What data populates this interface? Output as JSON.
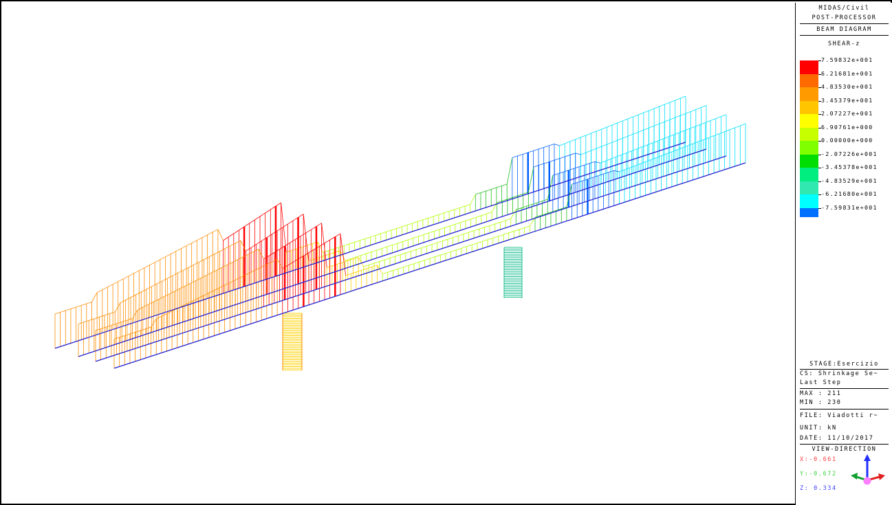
{
  "header": {
    "software": "MIDAS/Civil",
    "module": "POST-PROCESSOR",
    "diagram": "BEAM DIAGRAM",
    "component": "SHEAR-z"
  },
  "legend": {
    "labels": [
      "7.59832e+001",
      "6.21681e+001",
      "4.83530e+001",
      "3.45379e+001",
      "2.07227e+001",
      "6.90761e+000",
      "0.00000e+000",
      "-2.07226e+001",
      "-3.45378e+001",
      "-4.83529e+001",
      "-6.21680e+001",
      "-7.59831e+001"
    ],
    "colors": [
      "#ff0000",
      "#ff6a00",
      "#ff9a00",
      "#ffc600",
      "#ffff00",
      "#c8ff00",
      "#80ff00",
      "#00dd00",
      "#00ee80",
      "#30e8b0",
      "#00ffff",
      "#0070ff"
    ]
  },
  "info": {
    "stage": "STAGE:Esercizio",
    "cs_line1": "CS: Shrinkage Se~",
    "cs_line2": "Last Step",
    "max": "MAX : 211",
    "min": "MIN : 230",
    "file": "FILE: Viadotti r~",
    "unit": "UNIT: kN",
    "date": "DATE: 11/10/2017"
  },
  "view_direction": {
    "title": "VIEW-DIRECTION",
    "x": "X:-0.661",
    "y": "Y:-0.672",
    "z": "Z: 0.334",
    "x_color": "#ff4040",
    "y_color": "#40d040",
    "z_color": "#4040ff"
  },
  "colors": {
    "beam": "#2020d0",
    "orange": "#ff8c00",
    "red": "#ff0000",
    "yellow": "#ffd000",
    "lime": "#b0ff00",
    "green": "#20c020",
    "teal": "#20c090",
    "blue": "#0060ff",
    "cyan": "#00e0ff"
  }
}
